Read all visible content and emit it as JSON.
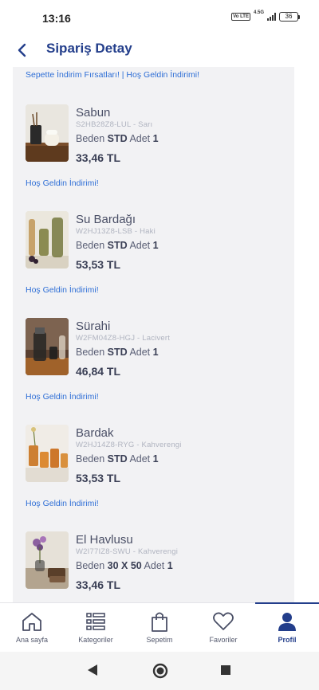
{
  "status": {
    "time": "13:16",
    "volte": "Vo LTE",
    "network": "4.5G",
    "battery": "36"
  },
  "header": {
    "title": "Sipariş Detay",
    "back_icon": "chevron-left-icon"
  },
  "promo_top": "Sepette İndirim Fırsatları! | Hoş Geldin İndirimi!",
  "labels": {
    "size_label": "Beden",
    "qty_label": "Adet"
  },
  "items": [
    {
      "name": "Sabun",
      "sku": "S2HB28Z8-LUL - Sarı",
      "size": "STD",
      "qty": "1",
      "price": "33,46 TL",
      "promo": "Hoş Geldin İndirimi!"
    },
    {
      "name": "Su Bardağı",
      "sku": "W2HJ13Z8-LSB - Haki",
      "size": "STD",
      "qty": "1",
      "price": "53,53 TL",
      "promo": "Hoş Geldin İndirimi!"
    },
    {
      "name": "Sürahi",
      "sku": "W2FM04Z8-HGJ - Lacivert",
      "size": "STD",
      "qty": "1",
      "price": "46,84 TL",
      "promo": "Hoş Geldin İndirimi!"
    },
    {
      "name": "Bardak",
      "sku": "W2HJ14Z8-RYG - Kahverengi",
      "size": "STD",
      "qty": "1",
      "price": "53,53 TL",
      "promo": "Hoş Geldin İndirimi!"
    },
    {
      "name": "El Havlusu",
      "sku": "W2I77IZ8-SWU - Kahverengi",
      "size": "30 X 50",
      "qty": "1",
      "price": "33,46 TL"
    }
  ],
  "nav": [
    {
      "label": "Ana sayfa",
      "icon": "home-icon"
    },
    {
      "label": "Kategoriler",
      "icon": "categories-icon"
    },
    {
      "label": "Sepetim",
      "icon": "shopping-bag-icon"
    },
    {
      "label": "Favoriler",
      "icon": "heart-icon"
    },
    {
      "label": "Profil",
      "icon": "user-icon",
      "active": true
    }
  ],
  "colors": {
    "brand": "#233e8b",
    "link": "#2f6fd6",
    "panel": "#f2f2f4"
  }
}
